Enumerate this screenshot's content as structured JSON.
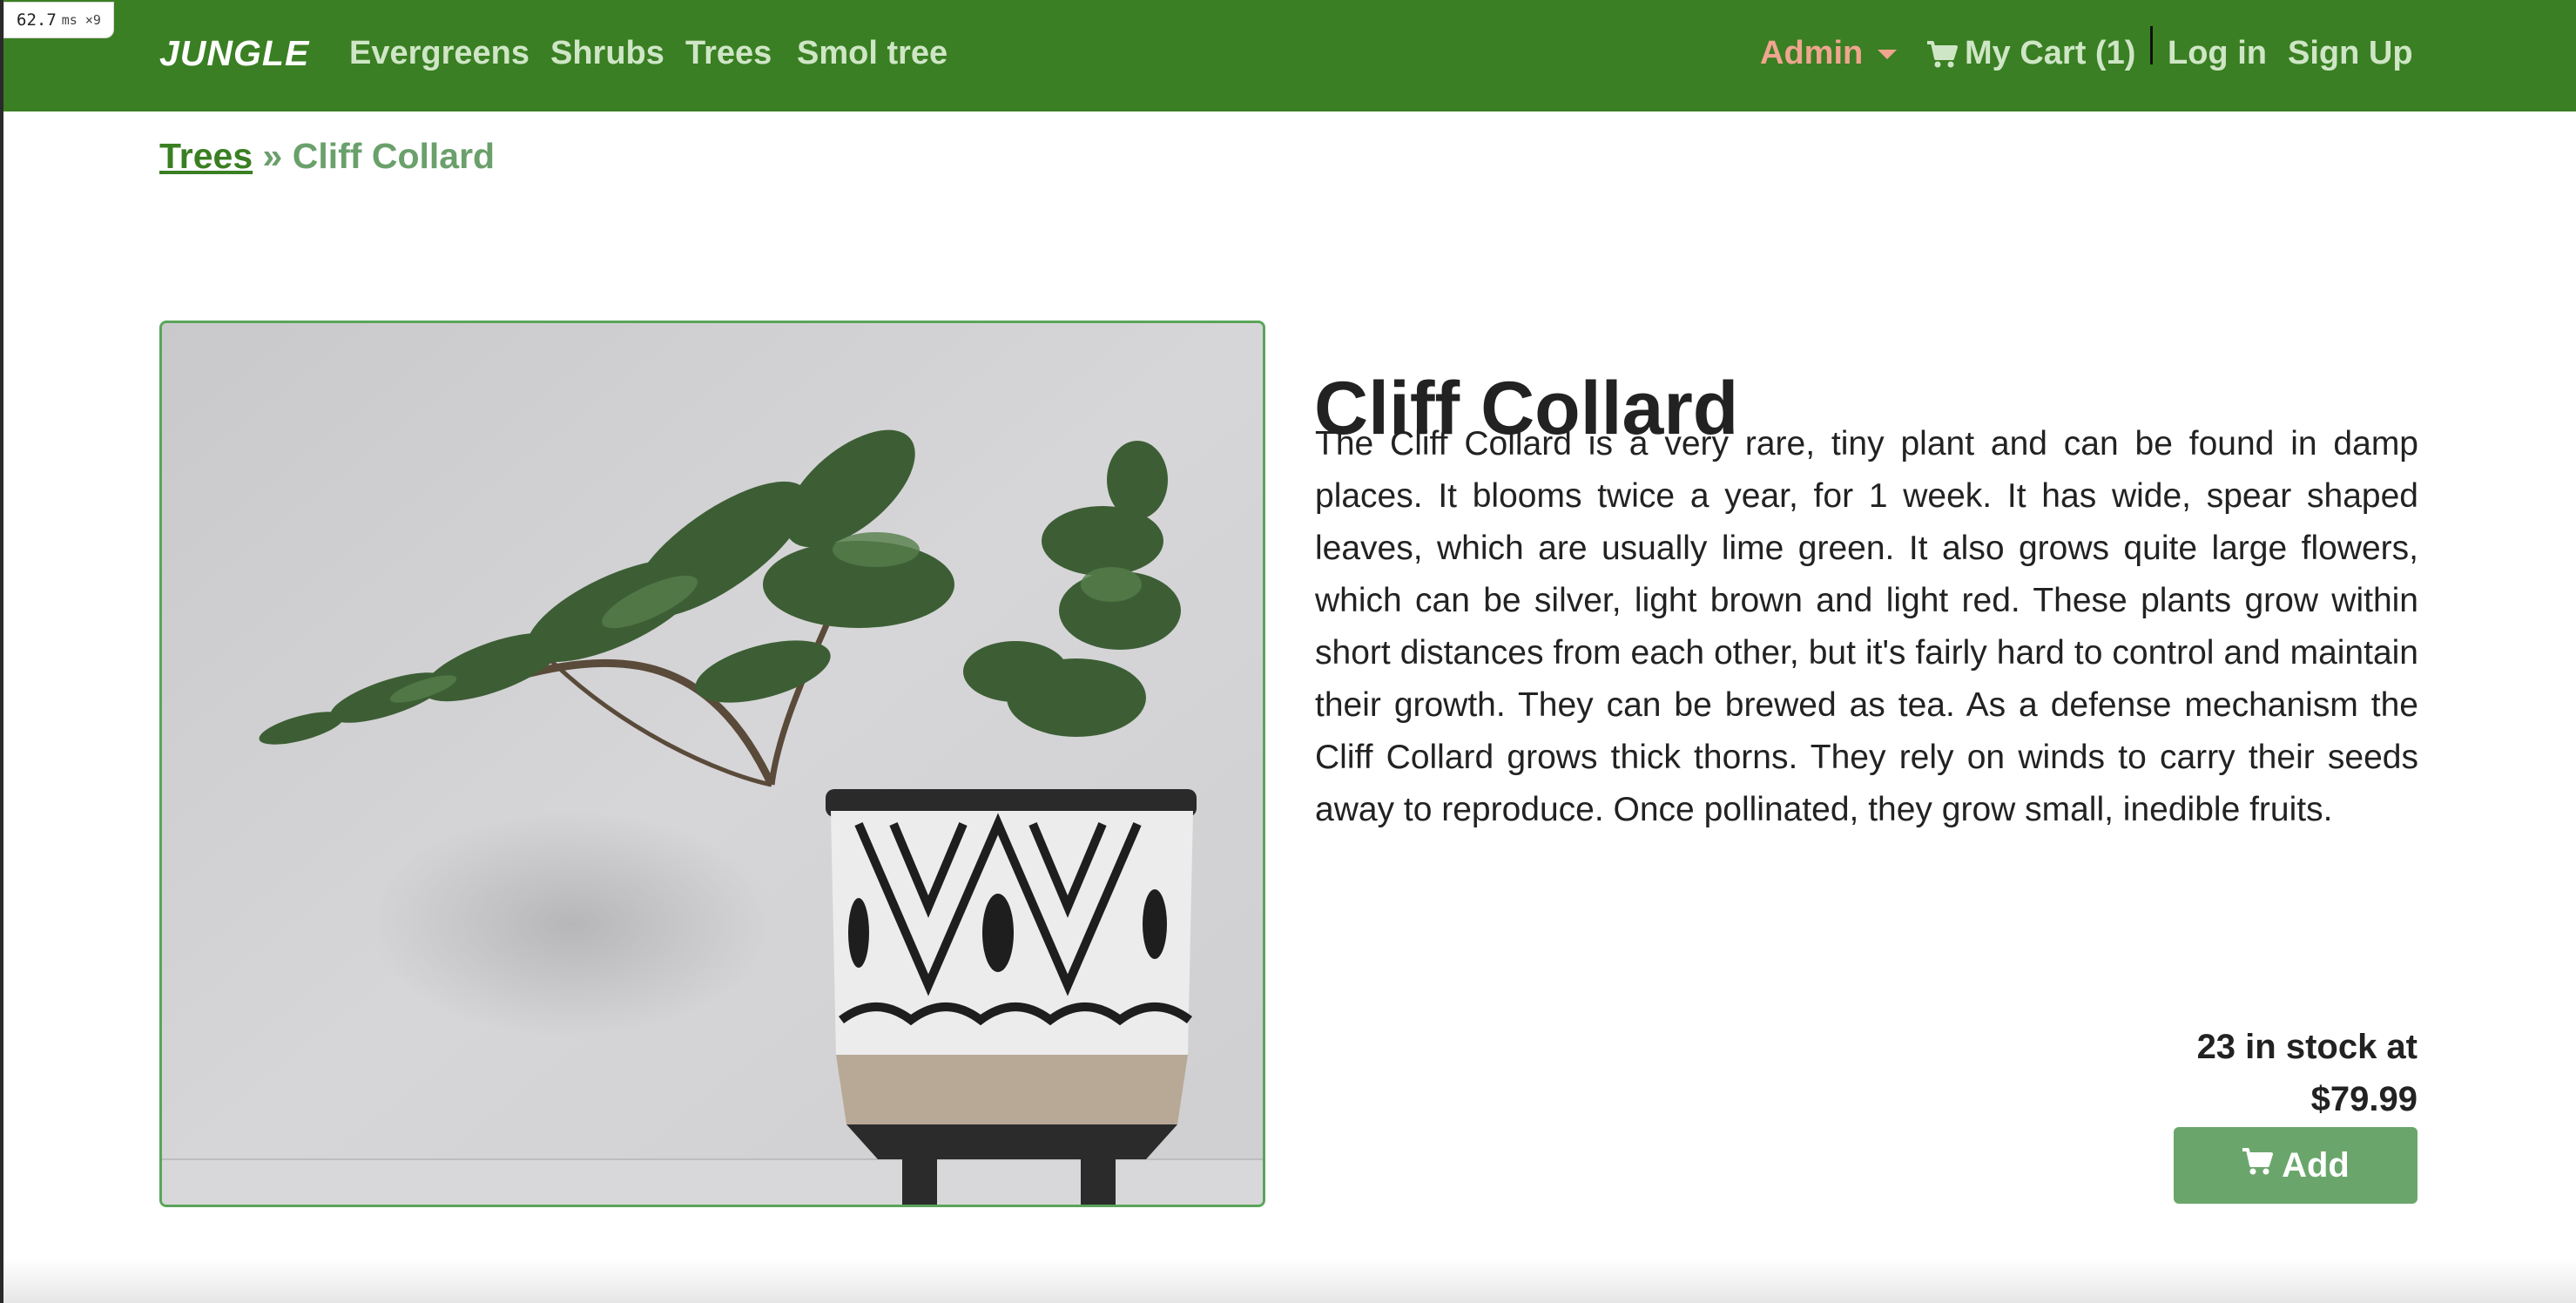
{
  "perf_overlay": {
    "value": "62.7",
    "unit": "ms ×9"
  },
  "nav": {
    "brand": "JUNGLE",
    "links": [
      "Evergreens",
      "Shrubs",
      "Trees",
      "Smol tree"
    ],
    "admin": "Admin",
    "cart": "My Cart (1)",
    "login": "Log in",
    "signup": "Sign Up"
  },
  "breadcrumb": {
    "parent": "Trees",
    "separator": " » ",
    "current": "Cliff Collard"
  },
  "product": {
    "name": "Cliff Collard",
    "description": "The Cliff Collard is a very rare, tiny plant and can be found in damp places. It blooms twice a year, for 1 week. It has wide, spear shaped leaves, which are usually lime green. It also grows quite large flowers, which can be silver, light brown and light red. These plants grow within short distances from each other, but it's fairly hard to control and maintain their growth. They can be brewed as tea. As a defense mechanism the Cliff Collard grows thick thorns. They rely on winds to carry their seeds away to reproduce. Once pollinated, they grow small, inedible fruits.",
    "stock_text": "23 in stock at",
    "price": "$79.99",
    "add_label": "Add"
  },
  "colors": {
    "navbar": "#3a7f23",
    "nav_link": "#cfe6c6",
    "admin": "#f0a58f",
    "button": "#6aa66b",
    "image_border": "#5aa45a"
  },
  "icons": {
    "cart": "cart-icon",
    "dropdown": "caret-down-icon"
  }
}
